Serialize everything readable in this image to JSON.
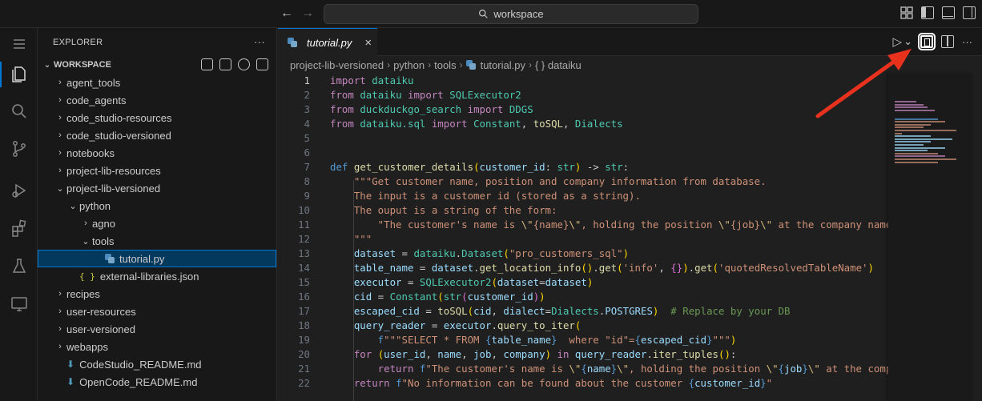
{
  "titlebar": {
    "back_icon": "arrow-left-icon",
    "forward_icon": "arrow-right-icon",
    "search_text": "workspace",
    "layout_icons": [
      "customize-layout-icon",
      "toggle-primary-sidebar-icon",
      "toggle-panel-icon",
      "toggle-secondary-sidebar-icon"
    ]
  },
  "activitybar": {
    "items": [
      "menu-icon",
      "explorer-icon",
      "search-icon",
      "source-control-icon",
      "run-debug-icon",
      "extensions-icon",
      "testing-icon",
      "remote-explorer-icon"
    ]
  },
  "sidebar": {
    "title": "EXPLORER",
    "more": "···",
    "section": "WORKSPACE",
    "tree": [
      {
        "label": "agent_tools",
        "twist": "›",
        "depth": 1
      },
      {
        "label": "code_agents",
        "twist": "›",
        "depth": 1
      },
      {
        "label": "code_studio-resources",
        "twist": "›",
        "depth": 1
      },
      {
        "label": "code_studio-versioned",
        "twist": "›",
        "depth": 1
      },
      {
        "label": "notebooks",
        "twist": "›",
        "depth": 1
      },
      {
        "label": "project-lib-resources",
        "twist": "›",
        "depth": 1
      },
      {
        "label": "project-lib-versioned",
        "twist": "⌄",
        "depth": 1
      },
      {
        "label": "python",
        "twist": "⌄",
        "depth": 2
      },
      {
        "label": "agno",
        "twist": "›",
        "depth": 3
      },
      {
        "label": "tools",
        "twist": "⌄",
        "depth": 3
      },
      {
        "label": "tutorial.py",
        "twist": "",
        "depth": 4
      },
      {
        "label": "external-libraries.json",
        "twist": "",
        "depth": 2
      },
      {
        "label": "recipes",
        "twist": "›",
        "depth": 1
      },
      {
        "label": "user-resources",
        "twist": "›",
        "depth": 1
      },
      {
        "label": "user-versioned",
        "twist": "›",
        "depth": 1
      },
      {
        "label": "webapps",
        "twist": "›",
        "depth": 1
      },
      {
        "label": "CodeStudio_README.md",
        "twist": "",
        "depth": 1
      },
      {
        "label": "OpenCode_README.md",
        "twist": "",
        "depth": 1
      }
    ]
  },
  "editor": {
    "tab_label": "tutorial.py",
    "tab_close": "×",
    "breadcrumbs": [
      "project-lib-versioned",
      "python",
      "tools",
      "tutorial.py",
      "{ } dataiku"
    ],
    "run_label": "▷",
    "run_dropdown": "⌄",
    "more": "···",
    "line_numbers": [
      "1",
      "2",
      "3",
      "4",
      "5",
      "6",
      "7",
      "8",
      "9",
      "10",
      "11",
      "12",
      "13",
      "14",
      "15",
      "16",
      "17",
      "18",
      "19",
      "20",
      "21",
      "22"
    ]
  },
  "colors": {
    "accent": "#0078d4",
    "annotation_arrow": "#e8321e"
  }
}
